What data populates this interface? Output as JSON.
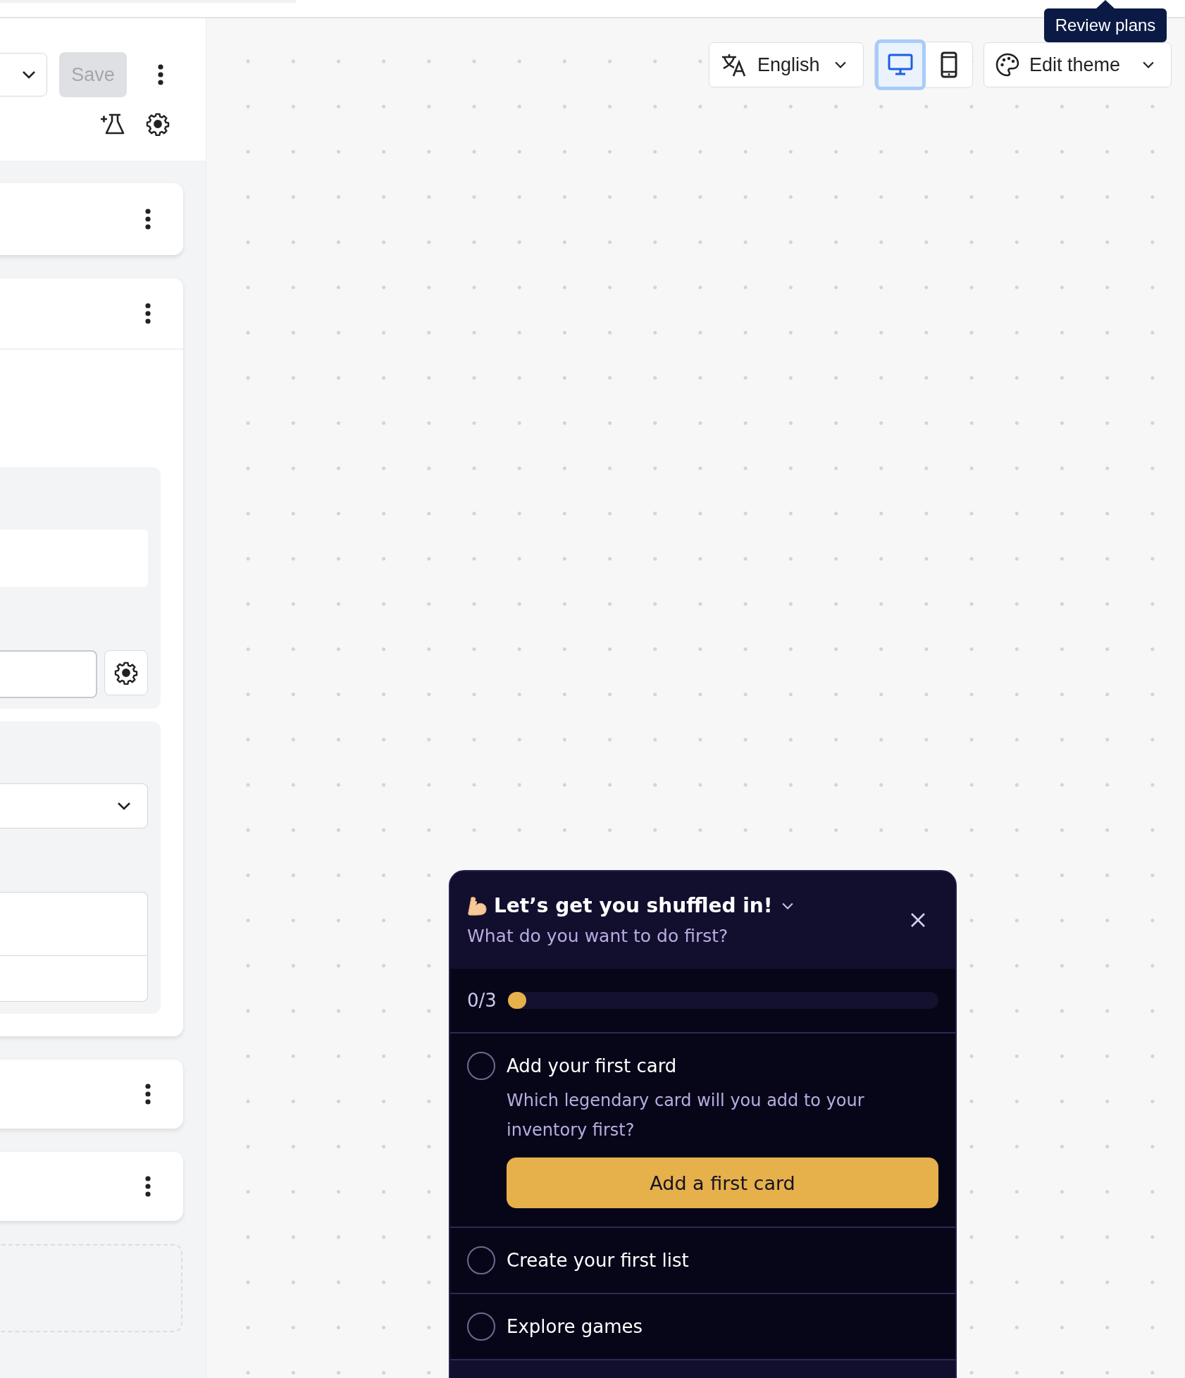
{
  "editor": {
    "save": {
      "label": "Save",
      "disabled": true
    }
  },
  "toolbar": {
    "language": "English",
    "devices": [
      {
        "kind": "desktop",
        "selected": true
      },
      {
        "kind": "mobile",
        "selected": false
      }
    ],
    "theme": "Edit theme",
    "tooltip": "Review plans"
  },
  "onboarding": {
    "title": "Let’s get you shuffled in!",
    "subtitle": "What do you want to do first?",
    "progress": {
      "reading": "0/3",
      "level": 0
    },
    "tasks": [
      {
        "title": "Add your first card",
        "checked": false,
        "expanded": true,
        "description": "Which legendary card will you add to your inventory first?",
        "action": "Add a first card"
      },
      {
        "title": "Create your first list",
        "checked": false,
        "expanded": false
      },
      {
        "title": "Explore games",
        "checked": false,
        "expanded": false
      }
    ]
  }
}
